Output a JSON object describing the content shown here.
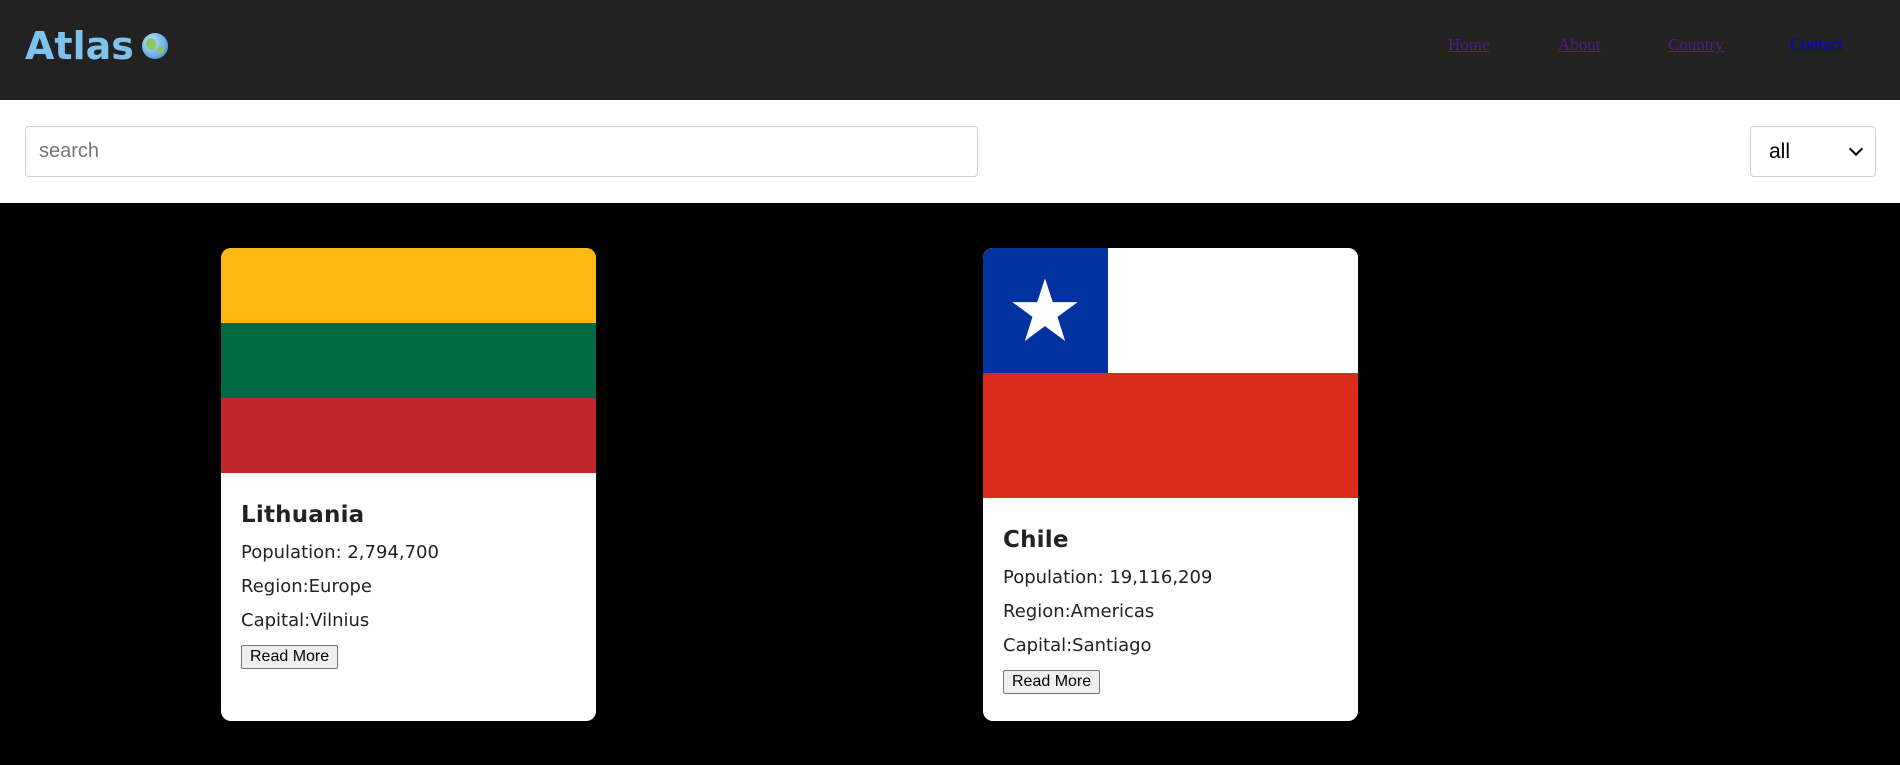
{
  "header": {
    "logo_text": "Atlas",
    "logo_icon": "globe-icon",
    "nav": [
      {
        "label": "Home",
        "color": "#551a8b"
      },
      {
        "label": "About",
        "color": "#551a8b"
      },
      {
        "label": "Country",
        "color": "#551a8b"
      },
      {
        "label": "Contact",
        "color": "#0000ee"
      }
    ]
  },
  "search": {
    "placeholder": "search",
    "value": ""
  },
  "filter": {
    "selected": "all"
  },
  "countries": [
    {
      "name": "Lithuania",
      "population_label": "Population: 2,794,700",
      "region_label": "Region:Europe",
      "capital_label": "Capital:Vilnius",
      "button_label": "Read More",
      "flag_colors": [
        "#fdb913",
        "#006a44",
        "#c1272d"
      ]
    },
    {
      "name": "Chile",
      "population_label": "Population: 19,116,209",
      "region_label": "Region:Americas",
      "capital_label": "Capital:Santiago",
      "button_label": "Read More",
      "flag_colors": [
        "#0033a0",
        "#ffffff",
        "#d92a1c"
      ]
    }
  ],
  "colors": {
    "header_bg": "#222222",
    "logo": "#7fc3ec",
    "main_bg": "#000000"
  }
}
